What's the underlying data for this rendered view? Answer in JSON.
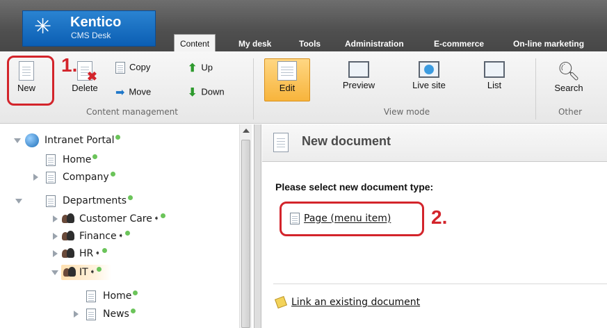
{
  "app": {
    "brand": "Kentico",
    "product": "CMS Desk"
  },
  "tabs": [
    {
      "label": "Content",
      "active": true
    },
    {
      "label": "My desk"
    },
    {
      "label": "Tools"
    },
    {
      "label": "Administration"
    },
    {
      "label": "E-commerce"
    },
    {
      "label": "On-line marketing"
    }
  ],
  "ribbon": {
    "content_management": {
      "label": "Content management",
      "new": "New",
      "delete": "Delete",
      "copy": "Copy",
      "move": "Move",
      "up": "Up",
      "down": "Down"
    },
    "view_mode": {
      "label": "View mode",
      "edit": "Edit",
      "preview": "Preview",
      "live_site": "Live site",
      "list": "List",
      "selected": "Edit"
    },
    "other": {
      "label": "Other",
      "search": "Search"
    }
  },
  "annotations": {
    "step1": "1.",
    "step2": "2.",
    "color": "#d3242b"
  },
  "tree": {
    "root": "Intranet Portal",
    "items": [
      {
        "label": "Home"
      },
      {
        "label": "Company"
      },
      {
        "label": "Departments"
      },
      {
        "label": "Customer Care"
      },
      {
        "label": "Finance"
      },
      {
        "label": "HR"
      },
      {
        "label": "IT",
        "selected": true
      },
      {
        "label": "Home"
      },
      {
        "label": "News"
      }
    ]
  },
  "content": {
    "title": "New document",
    "prompt": "Please select new document type:",
    "doc_type": "Page (menu item)",
    "link_existing": "Link an existing document"
  },
  "colors": {
    "accent": "#0b5eb3",
    "status_dot": "#6bc45a",
    "selected": "#f7b43c"
  }
}
